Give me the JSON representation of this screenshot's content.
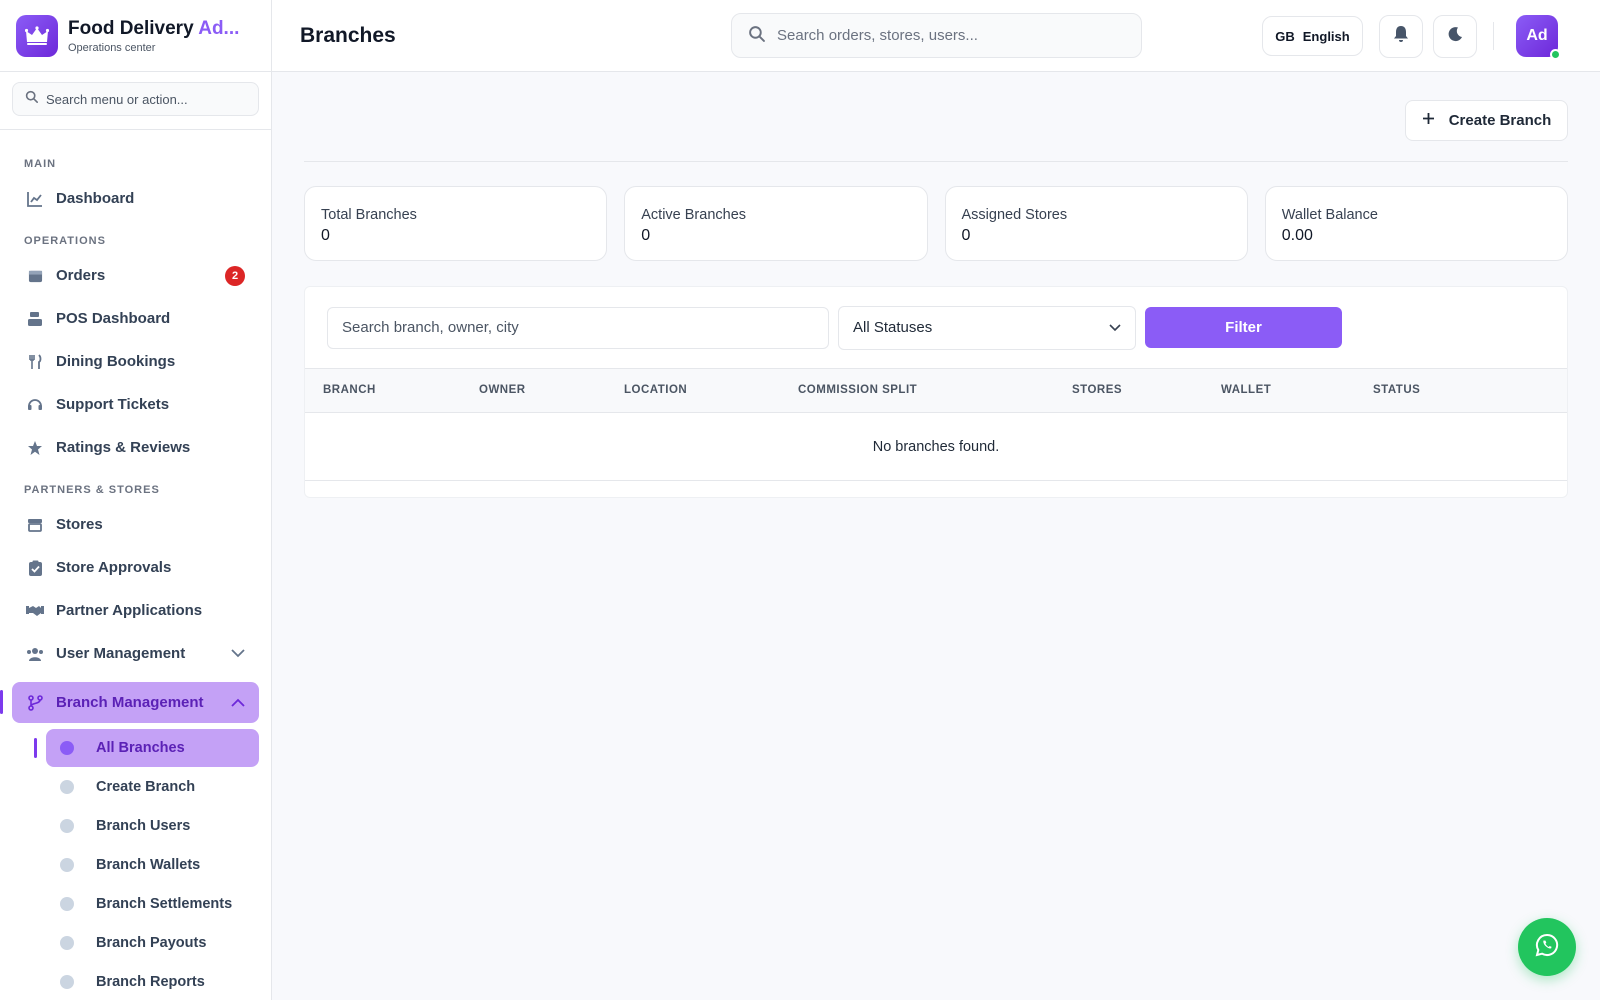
{
  "brand": {
    "title_main": "Food Delivery ",
    "title_accent": "Ad...",
    "subtitle": "Operations center"
  },
  "sidebar_search": {
    "placeholder": "Search menu or action..."
  },
  "sections": {
    "main": "MAIN",
    "operations": "OPERATIONS",
    "partners": "PARTNERS & STORES"
  },
  "nav": {
    "dashboard": "Dashboard",
    "orders": "Orders",
    "orders_badge": "2",
    "pos": "POS Dashboard",
    "dining": "Dining Bookings",
    "support": "Support Tickets",
    "ratings": "Ratings & Reviews",
    "stores": "Stores",
    "store_approvals": "Store Approvals",
    "partner_apps": "Partner Applications",
    "user_mgmt": "User Management",
    "branch_mgmt": "Branch Management",
    "sub": [
      "All Branches",
      "Create Branch",
      "Branch Users",
      "Branch Wallets",
      "Branch Settlements",
      "Branch Payouts",
      "Branch Reports"
    ]
  },
  "header": {
    "title": "Branches",
    "search_placeholder": "Search orders, stores, users...",
    "lang_code": "GB",
    "lang_name": "English",
    "avatar": "Ad"
  },
  "actions": {
    "create_branch": "Create Branch"
  },
  "stats": [
    {
      "label": "Total Branches",
      "value": "0"
    },
    {
      "label": "Active Branches",
      "value": "0"
    },
    {
      "label": "Assigned Stores",
      "value": "0"
    },
    {
      "label": "Wallet Balance",
      "value": "0.00"
    }
  ],
  "filters": {
    "search_placeholder": "Search branch, owner, city",
    "status_selected": "All Statuses",
    "filter_button": "Filter"
  },
  "table": {
    "columns": [
      "BRANCH",
      "OWNER",
      "LOCATION",
      "COMMISSION SPLIT",
      "STORES",
      "WALLET",
      "STATUS"
    ],
    "empty_message": "No branches found."
  },
  "colors": {
    "accent": "#8b5cf6",
    "accent_dark": "#6d28d9",
    "active_bg": "#c4a1f6",
    "badge": "#dc2626",
    "whatsapp": "#22c55e"
  },
  "icons": {
    "brand": "crown-icon",
    "search": "search-icon",
    "bell": "bell-icon",
    "theme": "moon-icon",
    "whatsapp": "whatsapp-icon"
  }
}
